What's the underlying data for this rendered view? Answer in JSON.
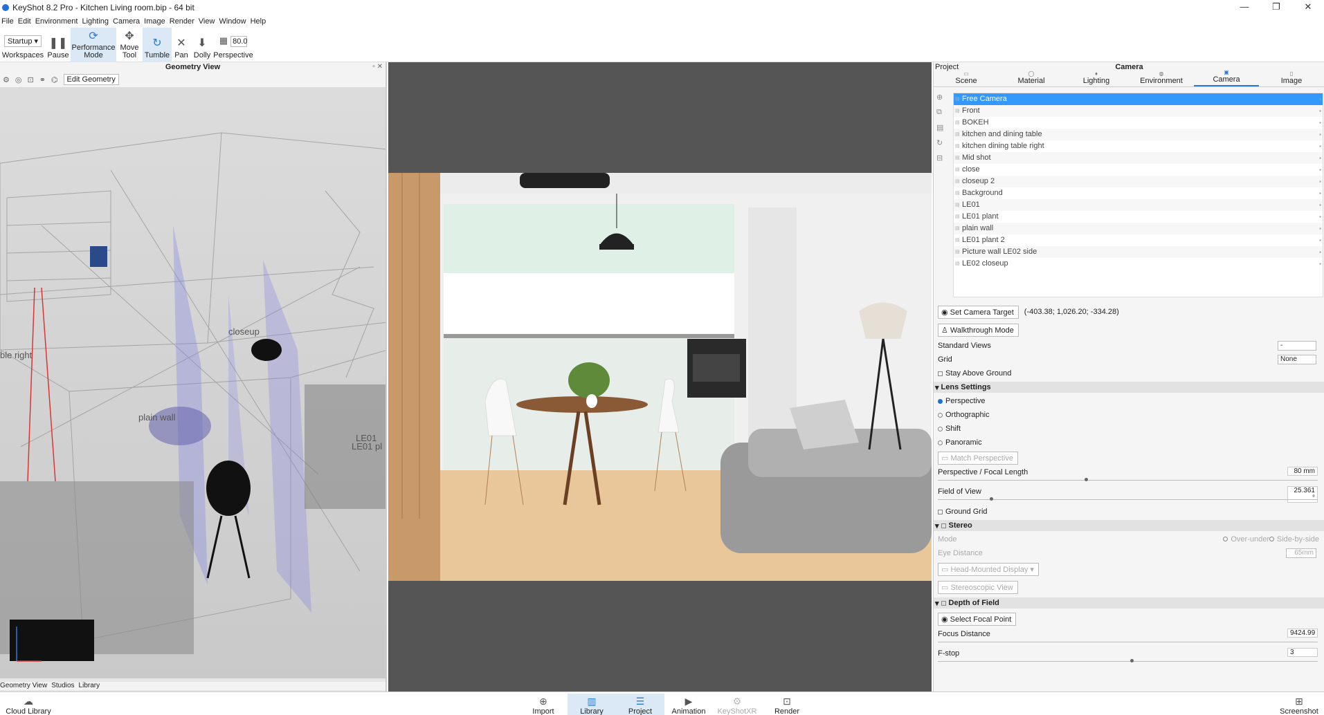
{
  "window": {
    "title": "KeyShot 8.2 Pro  - Kitchen Living room.bip  - 64 bit",
    "controls": [
      "—",
      "❐",
      "✕"
    ]
  },
  "menu": [
    "File",
    "Edit",
    "Environment",
    "Lighting",
    "Camera",
    "Image",
    "Render",
    "View",
    "Window",
    "Help"
  ],
  "toolbar": {
    "workspace_value": "Startup",
    "workspaces_label": "Workspaces",
    "pause_label": "Pause",
    "performance_label_1": "Performance",
    "performance_label_2": "Mode",
    "move_label_1": "Move",
    "move_label_2": "Tool",
    "tumble_label": "Tumble",
    "pan_label": "Pan",
    "dolly_label": "Dolly",
    "fov_value": "80.0",
    "perspective_label": "Perspective"
  },
  "geometry_view": {
    "title": "Geometry View",
    "edit_button": "Edit Geometry",
    "labels": [
      "closeup",
      "plain wall",
      "ble right",
      "LE01",
      "LE01 pl"
    ],
    "bottom_tabs": [
      "Geometry View",
      "Studios",
      "Library"
    ]
  },
  "project_panel": {
    "project_label": "Project",
    "title": "Camera",
    "tabs": [
      "Scene",
      "Material",
      "Lighting",
      "Environment",
      "Camera",
      "Image"
    ],
    "active_tab": "Camera",
    "cameras": [
      "Free Camera",
      "Front",
      "BOKEH",
      "kitchen and dining table",
      "kitchen dining table right",
      "Mid shot",
      "close",
      "closeup 2",
      "Background",
      "LE01",
      "LE01 plant",
      "plain wall",
      "LE01 plant 2",
      "Picture wall LE02 side",
      "LE02 closeup"
    ],
    "selected_camera": "Free Camera",
    "set_camera_target": "Set Camera Target",
    "camera_target_coords": "(-403.38; 1,026.20; -334.28)",
    "walkthrough_mode": "Walkthrough Mode",
    "standard_views_label": "Standard Views",
    "standard_views_value": "-",
    "grid_label": "Grid",
    "grid_value": "None",
    "stay_above_ground": "Stay Above Ground",
    "lens_settings": "Lens Settings",
    "lens_options": [
      "Perspective",
      "Orthographic",
      "Shift",
      "Panoramic"
    ],
    "match_perspective": "Match Perspective",
    "focal_length_label": "Perspective / Focal Length",
    "focal_length_value": "80 mm",
    "focal_length_fraction": 0.39,
    "fov_label": "Field of View",
    "fov_value": "25.361 °",
    "fov_fraction": 0.14,
    "ground_grid": "Ground Grid",
    "stereo": "Stereo",
    "mode_label": "Mode",
    "over_under": "Over-under",
    "side_by_side": "Side-by-side",
    "eye_distance_label": "Eye Distance",
    "eye_distance_value": "65mm",
    "head_mounted": "Head-Mounted Display",
    "stereoscopic_view": "Stereoscopic View",
    "depth_of_field": "Depth of Field",
    "select_focal_point": "Select Focal Point",
    "focus_distance_label": "Focus Distance",
    "focus_distance_value": "9424.99",
    "fstop_label": "F-stop",
    "fstop_value": "3",
    "fstop_fraction": 0.51
  },
  "bottom_bar": {
    "cloud_library": "Cloud Library",
    "import": "Import",
    "library": "Library",
    "project": "Project",
    "animation": "Animation",
    "keyshotxr": "KeyShotXR",
    "render": "Render",
    "screenshot": "Screenshot"
  },
  "colors": {
    "accent": "#2a7ad6",
    "selection": "#3399ff",
    "active_tool": "#dbe9f7"
  }
}
